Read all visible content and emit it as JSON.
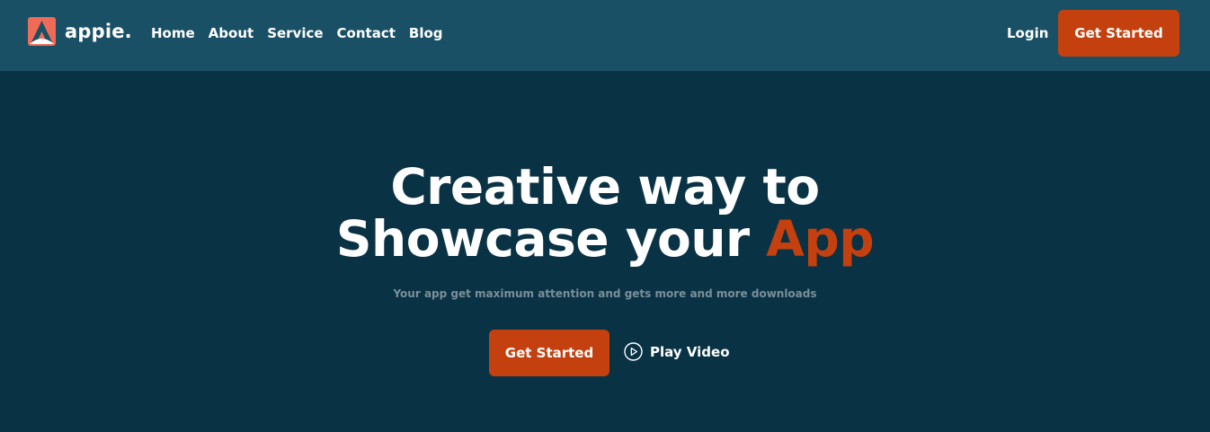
{
  "brand": {
    "name": "appie.",
    "icon": "appie-logo-icon"
  },
  "nav": {
    "links": [
      "Home",
      "About",
      "Service",
      "Contact",
      "Blog"
    ],
    "login_label": "Login",
    "cta_label": "Get Started"
  },
  "hero": {
    "title_line1": "Creative way to",
    "title_line2_main": "Showcase your",
    "title_line2_accent": "App",
    "subtitle": "Your app get maximum attention and gets more and more downloads",
    "primary_cta": "Get Started",
    "play_label": "Play Video",
    "play_icon": "play-circle-icon"
  },
  "colors": {
    "nav_background": "#1a5066",
    "page_background": "#0a3245",
    "accent": "#c4400f",
    "subtitle_text": "#7a8f99",
    "logo_coral": "#f06b57"
  }
}
